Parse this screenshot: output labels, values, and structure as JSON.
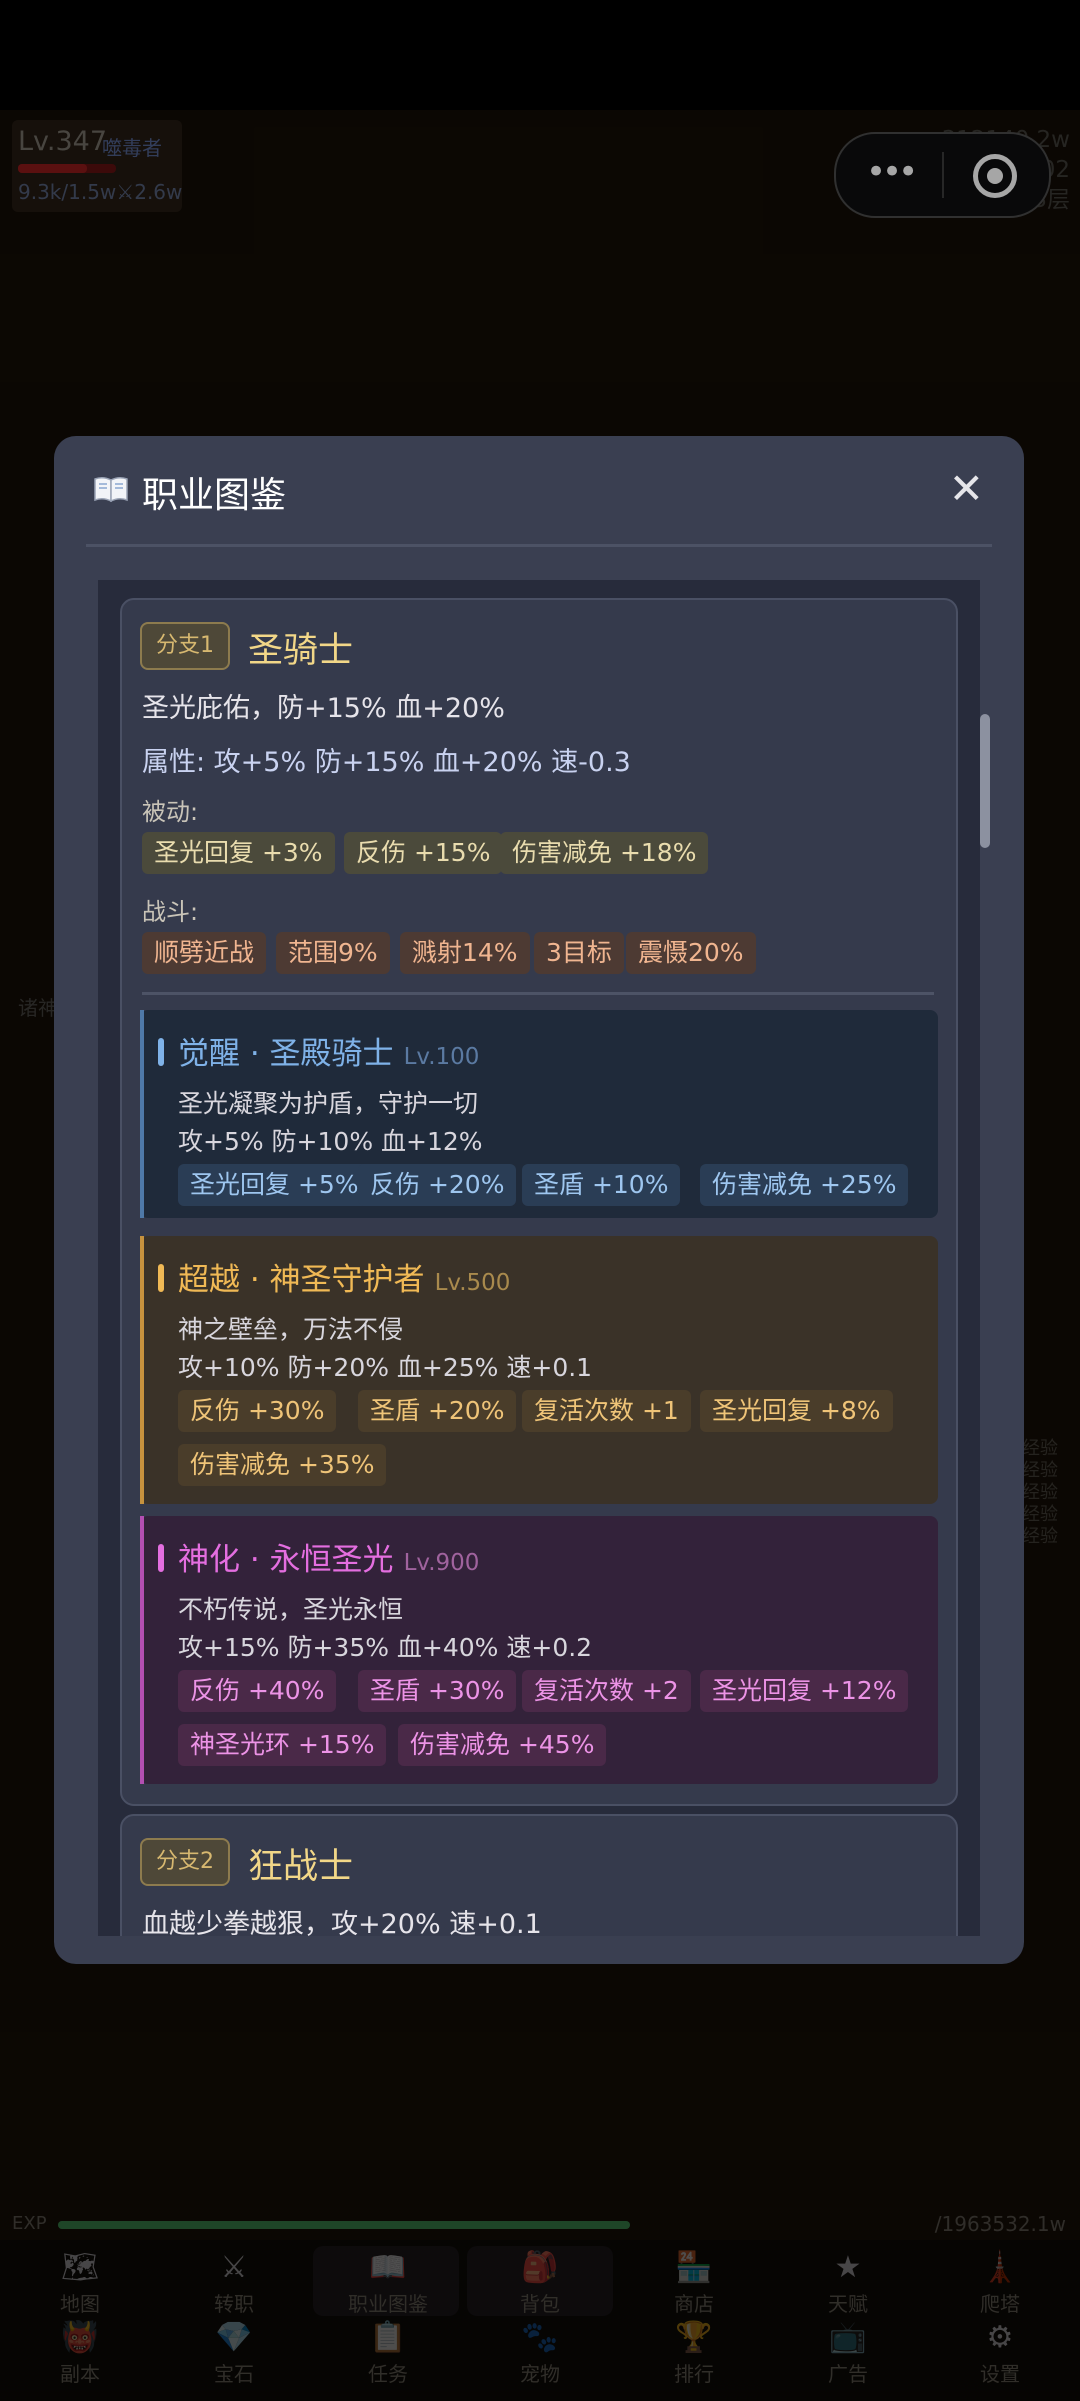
{
  "hud": {
    "level": "Lv.347",
    "job": "噬毒者",
    "stats": "9.3k/1.5w⚔2.6w",
    "hp_fraction": 0.7,
    "gold": "312140.2w",
    "gems": "802",
    "floor": "43层"
  },
  "side_text": {
    "left": "诸神",
    "right": [
      "经验",
      "经验",
      "经验",
      "经验",
      "经验"
    ]
  },
  "exp": {
    "label": "EXP",
    "value": "/1963532.1w",
    "fraction": 1.0
  },
  "modal": {
    "title": "职业图鉴",
    "close": "✕"
  },
  "branch1": {
    "tag": "分支1",
    "name": "圣骑士",
    "desc": "圣光庇佑，防+15% 血+20%",
    "attrs": "属性: 攻+5% 防+15% 血+20% 速-0.3",
    "passive_label": "被动:",
    "passives": [
      "圣光回复 +3%",
      "反伤 +15%",
      "伤害减免 +18%"
    ],
    "combat_label": "战斗:",
    "combats": [
      "顺劈近战",
      "范围9%",
      "溅射14%",
      "3目标",
      "震慑20%"
    ]
  },
  "stages": [
    {
      "title": "觉醒 · 圣殿骑士",
      "lv": "Lv.100",
      "desc": "圣光凝聚为护盾，守护一切",
      "attrs": "攻+5% 防+10% 血+12%",
      "chips": [
        "圣光回复 +5%",
        "反伤 +20%",
        "圣盾 +10%",
        "伤害减免 +25%"
      ],
      "color": "#7fb2e8",
      "lvcolor": "#5b7aa2",
      "bg": "#1f2a3a",
      "barcolor": "#4f79a8",
      "chipbg": "#2a3d55",
      "chipfg": "#9ec6ef"
    },
    {
      "title": "超越 · 神圣守护者",
      "lv": "Lv.500",
      "desc": "神之壁垒，万法不侵",
      "attrs": "攻+10% 防+20% 血+25% 速+0.1",
      "chips": [
        "反伤 +30%",
        "圣盾 +20%",
        "复活次数 +1",
        "圣光回复 +8%",
        "伤害减免 +35%"
      ],
      "color": "#f0b955",
      "lvcolor": "#a98a4d",
      "bg": "#3a3228",
      "barcolor": "#c6923e",
      "chipbg": "#4a3d2a",
      "chipfg": "#efc478"
    },
    {
      "title": "神化 · 永恒圣光",
      "lv": "Lv.900",
      "desc": "不朽传说，圣光永恒",
      "attrs": "攻+15% 防+35% 血+40% 速+0.2",
      "chips": [
        "反伤 +40%",
        "圣盾 +30%",
        "复活次数 +2",
        "圣光回复 +12%",
        "神圣光环 +15%",
        "伤害减免 +45%"
      ],
      "color": "#e46ee0",
      "lvcolor": "#a0639e",
      "bg": "#33223a",
      "barcolor": "#b34fb2",
      "chipbg": "#4a2948",
      "chipfg": "#ec93e6"
    }
  ],
  "branch2": {
    "tag": "分支2",
    "name": "狂战士",
    "desc": "血越少拳越狠，攻+20% 速+0.1"
  },
  "nav": {
    "row1": [
      {
        "label": "地图",
        "icon": "map-icon",
        "glyph": "🗺"
      },
      {
        "label": "转职",
        "icon": "crossed-swords-icon",
        "glyph": "⚔"
      },
      {
        "label": "职业图鉴",
        "icon": "book-icon",
        "glyph": "📖"
      },
      {
        "label": "背包",
        "icon": "backpack-icon",
        "glyph": "🎒"
      },
      {
        "label": "商店",
        "icon": "shop-icon",
        "glyph": "🏪"
      },
      {
        "label": "天赋",
        "icon": "star-icon",
        "glyph": "★"
      },
      {
        "label": "爬塔",
        "icon": "tower-icon",
        "glyph": "🗼"
      }
    ],
    "row2": [
      {
        "label": "副本",
        "icon": "demon-mask-icon",
        "glyph": "👹"
      },
      {
        "label": "宝石",
        "icon": "gem-icon",
        "glyph": "💎"
      },
      {
        "label": "任务",
        "icon": "clipboard-icon",
        "glyph": "📋"
      },
      {
        "label": "宠物",
        "icon": "paw-icon",
        "glyph": "🐾"
      },
      {
        "label": "排行",
        "icon": "trophy-icon",
        "glyph": "🏆"
      },
      {
        "label": "广告",
        "icon": "tv-icon",
        "glyph": "📺"
      },
      {
        "label": "设置",
        "icon": "gear-icon",
        "glyph": "⚙"
      }
    ]
  }
}
